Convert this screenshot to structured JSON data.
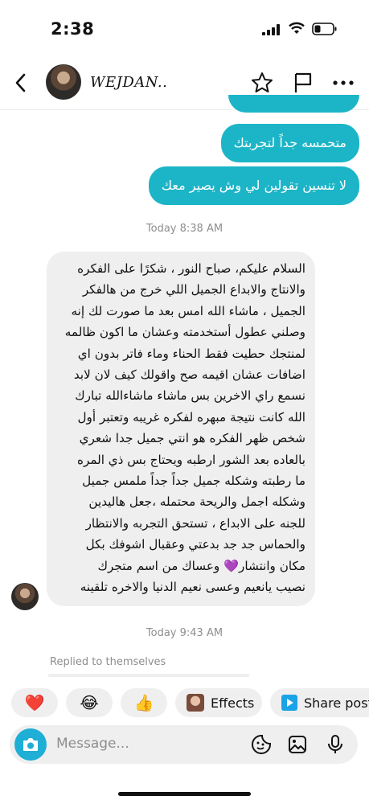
{
  "status_bar": {
    "time": "2:38"
  },
  "header": {
    "contact_name": "WEJDAN.."
  },
  "messages": {
    "sent_1": "متحمسه جداً لتجربتك",
    "sent_2": "لا تنسين تقولين لي وش يصير معك",
    "timestamp_1": "Today 8:38 AM",
    "received_lines": [
      "السلام عليكم، صباح النور ، شكرًا على الفكره",
      "والانتاج والابداع الجميل اللي خرج من هالفكر",
      "الجميل ، ماشاء الله امس بعد ما صورت لك إنه",
      "وصلني عطول أستخدمته وعشان ما اكون ظالمه",
      "لمنتجك حطيت فقط الحناء وماء فاتر بدون اي",
      "اضافات عشان اقيمه صح واقولك كيف لان لابد",
      "نسمع راي الاخرين بس ماشاء ماشاءالله تبارك",
      "الله كانت نتيجة مبهره لفكره غريبه وتعتبر أول",
      "شخص ظهر الفكره هو انتي جميل جدا شعري",
      "بالعاده بعد الشور ارطبه ويحتاج بس ذي المره",
      "ما رطبته وشكله جميل جداً جداً ملمس جميل",
      "وشكله اجمل والريحة محتمله ،جعل هاليدين",
      "للجنه على الابداع ، تستحق التجربه والانتظار",
      "والحماس جد جد بدعتي وعقبال اشوفك بكل",
      "مكان وانتشار💜 وعساك من اسم متجرك",
      "نصيب يانعيم وعسى نعيم الدنيا والاخره تلقينه"
    ],
    "timestamp_2": "Today 9:43 AM",
    "replied_label": "Replied to themselves"
  },
  "reactions": {
    "heart": "❤️",
    "laugh": "😂",
    "thumbs": "👍",
    "effects_label": "Effects",
    "share_label": "Share post"
  },
  "composer": {
    "placeholder": "Message..."
  },
  "colors": {
    "accent": "#1cb5c7",
    "bubble_in": "#efefef",
    "muted": "#8e8e8e"
  }
}
